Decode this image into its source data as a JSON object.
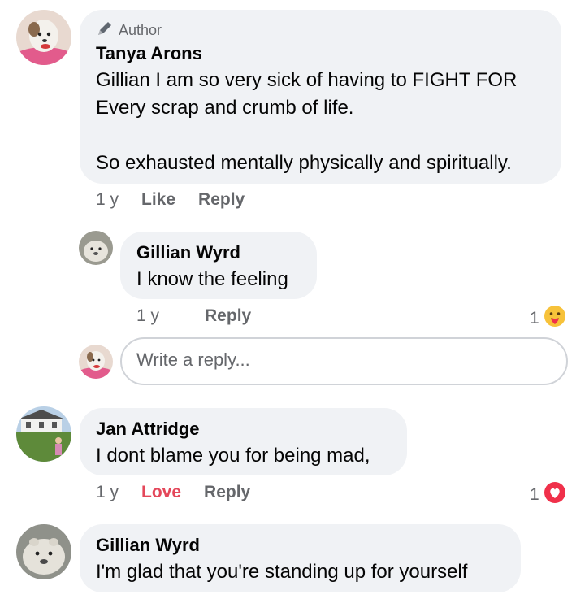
{
  "comment1": {
    "badge": "Author",
    "author": "Tanya Arons",
    "text_line1": "Gillian I am so very sick of having to FIGHT FOR",
    "text_line2": "Every scrap and crumb of life.",
    "text_line3": "So exhausted mentally physically and spiritually.",
    "time": "1 y",
    "like": "Like",
    "reply": "Reply"
  },
  "reply1": {
    "author": "Gillian Wyrd",
    "text": "I know the feeling",
    "time": "1 y",
    "reply": "Reply",
    "reaction_count": "1"
  },
  "reply_box": {
    "placeholder": "Write a reply..."
  },
  "comment2": {
    "author": "Jan Attridge",
    "text": "I dont blame you for being mad,",
    "time": "1 y",
    "love": "Love",
    "reply": "Reply",
    "reaction_count": "1"
  },
  "comment3": {
    "author": "Gillian Wyrd",
    "text": "I'm glad that you're standing up for yourself"
  },
  "colors": {
    "bubble": "#f0f2f5",
    "meta": "#65676b",
    "love": "#e4475a"
  },
  "icons": {
    "author_badge": "pen-icon",
    "care_reaction": "care-emoji-icon",
    "love_reaction": "heart-icon"
  }
}
